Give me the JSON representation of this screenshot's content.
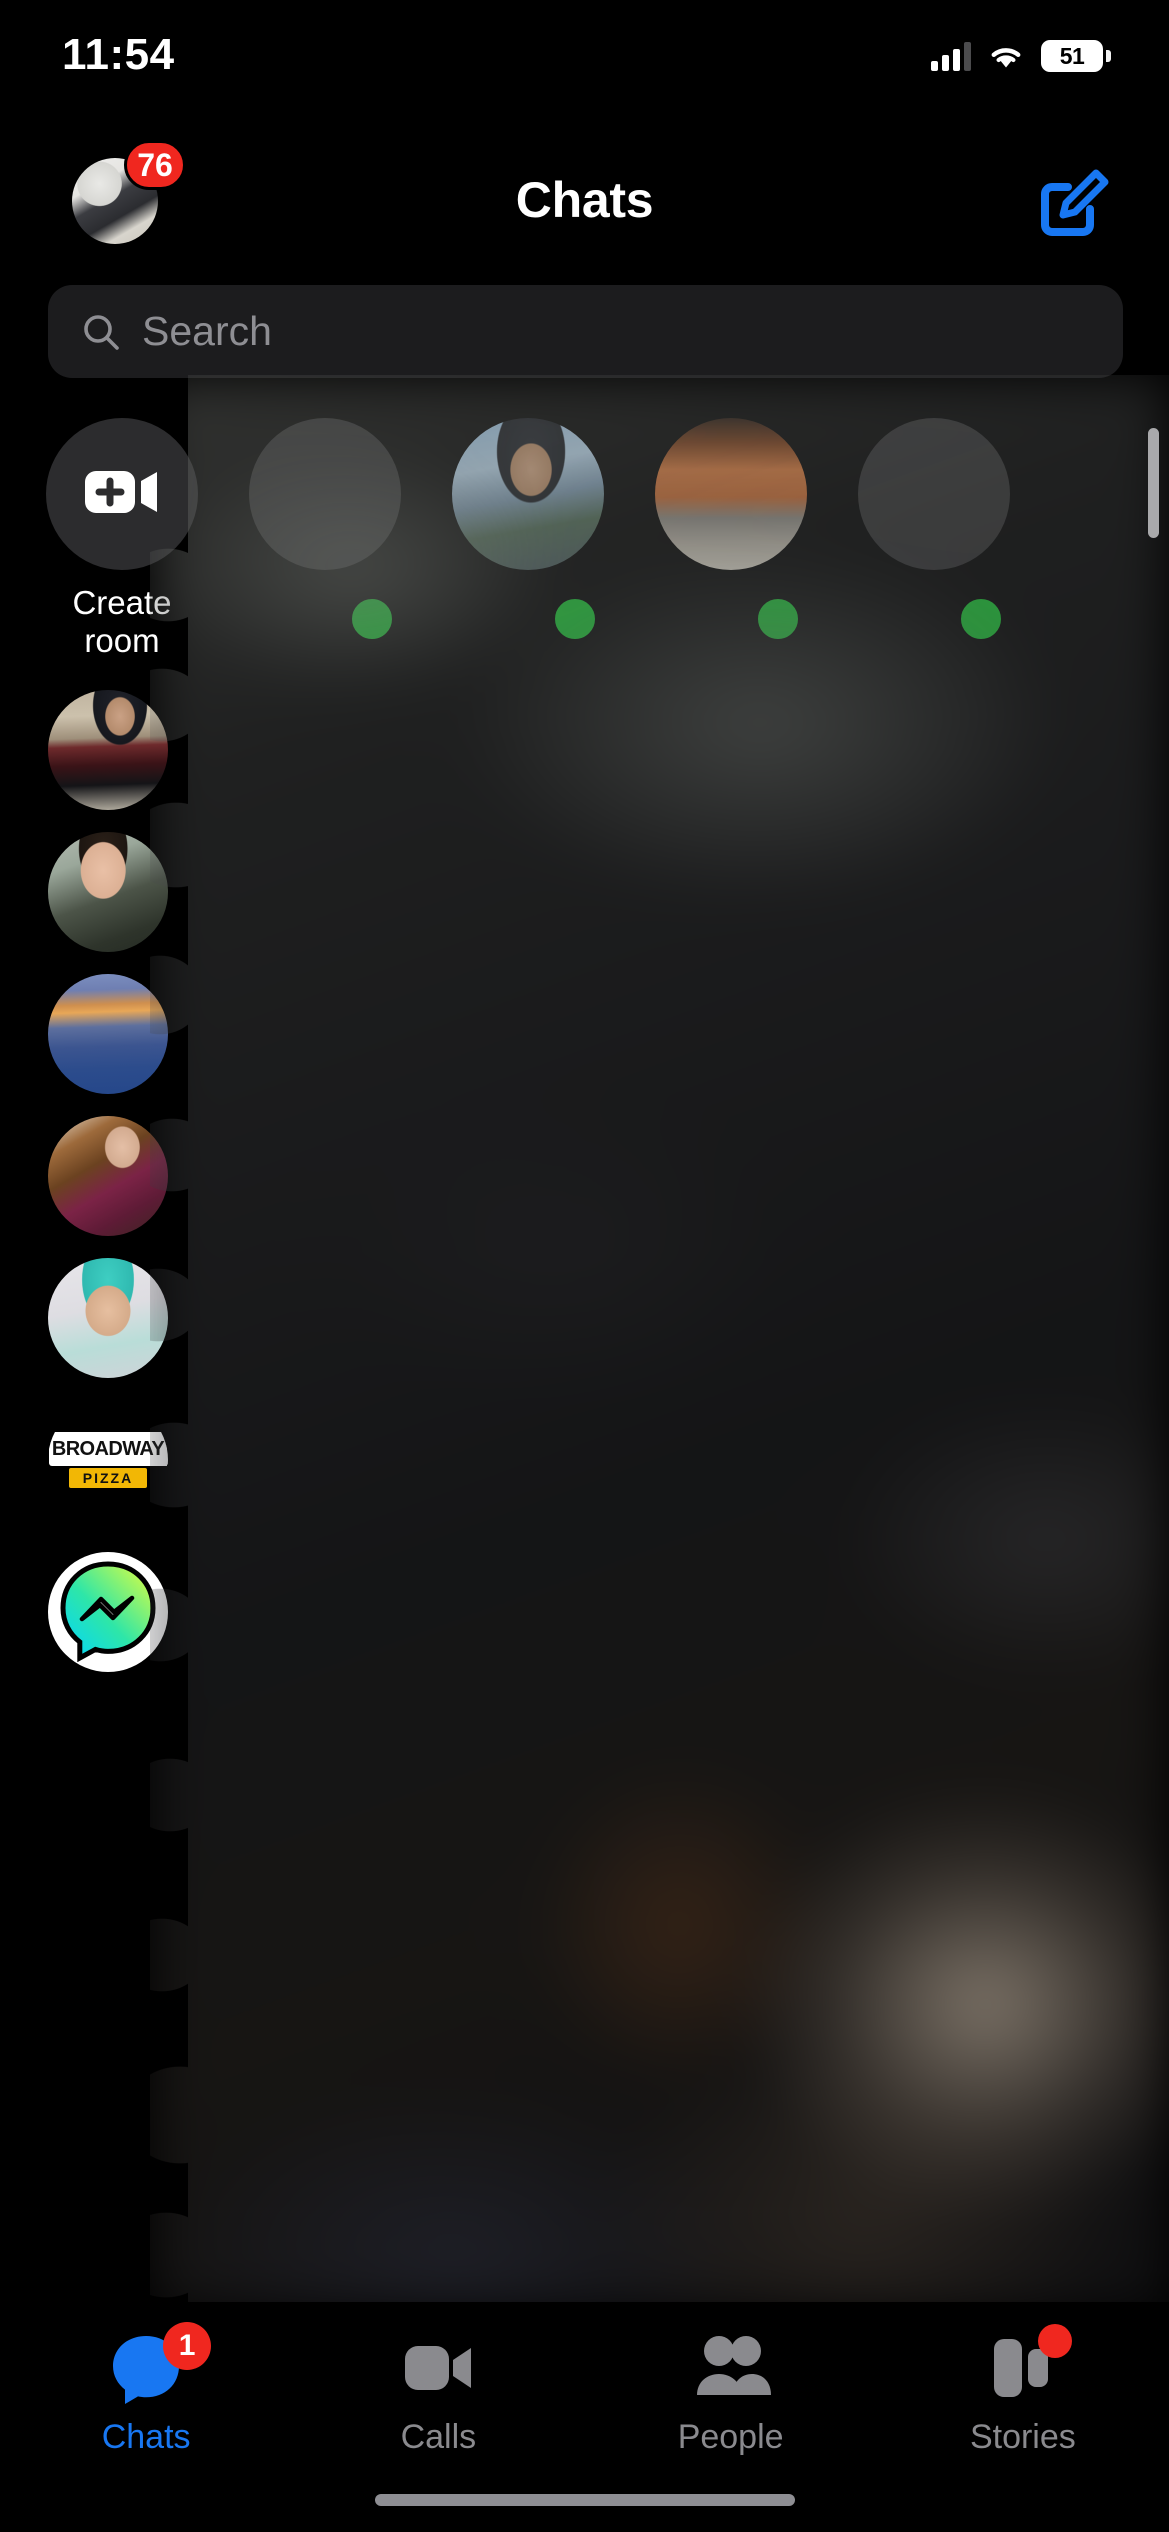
{
  "status_bar": {
    "time": "11:54",
    "battery_level": "51",
    "cellular_icon": "signal-bars-icon",
    "wifi_icon": "wifi-icon",
    "battery_icon": "battery-icon"
  },
  "nav": {
    "title": "Chats",
    "profile_badge": "76",
    "profile_icon": "avatar",
    "compose_icon": "compose-edit-icon"
  },
  "search": {
    "placeholder": "Search",
    "value": "",
    "icon": "search-icon"
  },
  "active_row": {
    "items": [
      {
        "label_line1": "Create",
        "label_line2": "room",
        "icon": "video-plus-icon",
        "online": false,
        "kind": "create-room"
      },
      {
        "label_line1": "",
        "label_line2": "",
        "icon": "avatar-placeholder",
        "online": true,
        "kind": "placeholder"
      },
      {
        "label_line1": "",
        "label_line2": "",
        "icon": "avatar-photo",
        "online": true,
        "kind": "photo-boy-mountain"
      },
      {
        "label_line1": "",
        "label_line2": "",
        "icon": "avatar-photo",
        "online": true,
        "kind": "photo-boy-stairs"
      },
      {
        "label_line1": "",
        "label_line2": "",
        "icon": "avatar-placeholder",
        "online": true,
        "kind": "placeholder"
      }
    ]
  },
  "chat_list": {
    "rows": [
      {
        "avatar": "avatar-mountain-man",
        "name": "",
        "preview": "",
        "time": "",
        "redacted": true
      },
      {
        "avatar": "avatar-young-woman",
        "name": "",
        "preview": "",
        "time": "",
        "redacted": true
      },
      {
        "avatar": "avatar-ship-sunset",
        "name": "",
        "preview": "",
        "time": "",
        "redacted": true
      },
      {
        "avatar": "avatar-woman-maroon",
        "name": "",
        "preview": "",
        "time": "",
        "redacted": true
      },
      {
        "avatar": "avatar-doctor-scrubs",
        "name": "",
        "preview": "",
        "time": "",
        "redacted": true
      },
      {
        "avatar": "avatar-broadway-pizza",
        "name": "",
        "preview": "",
        "time": "",
        "redacted": true,
        "logo_text": "BROADWAY",
        "logo_sub": "PIZZA"
      },
      {
        "avatar": "avatar-messenger-logo",
        "name": "",
        "preview": "",
        "time": "",
        "redacted": true
      }
    ]
  },
  "tab_bar": {
    "tabs": [
      {
        "label": "Chats",
        "icon": "chat-bubble-icon",
        "active": true,
        "badge": "1",
        "dot": false
      },
      {
        "label": "Calls",
        "icon": "video-camera-icon",
        "active": false,
        "badge": "",
        "dot": false
      },
      {
        "label": "People",
        "icon": "people-icon",
        "active": false,
        "badge": "",
        "dot": false
      },
      {
        "label": "Stories",
        "icon": "stories-icon",
        "active": false,
        "badge": "",
        "dot": true
      }
    ]
  },
  "colors": {
    "accent_blue": "#1877f2",
    "badge_red": "#f0271f",
    "online_green": "#17c431",
    "background": "#000000",
    "search_field": "#1c1c1e",
    "inactive_tab": "#8a8a8e"
  }
}
